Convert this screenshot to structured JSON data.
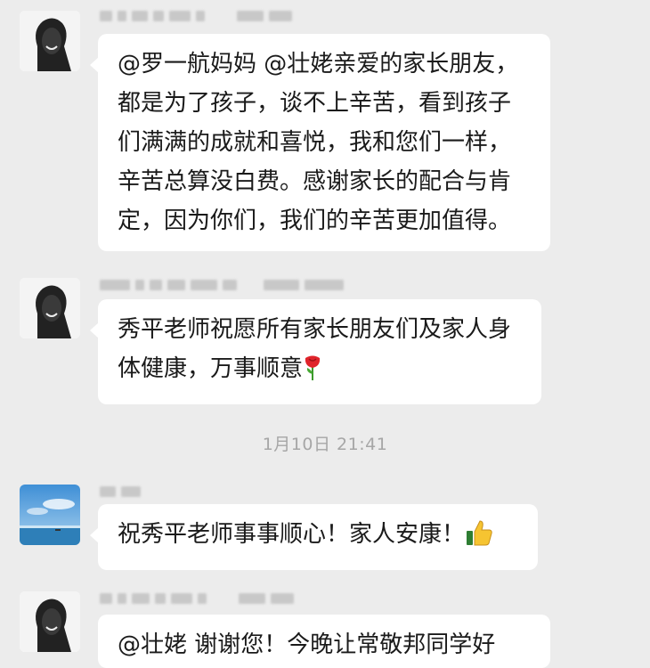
{
  "messages": [
    {
      "avatar": "dark-silhouette-avatar",
      "text": "@罗一航妈妈 @壮姥亲爱的家长朋友， 都是为了孩子，谈不上辛苦，看到孩子们满满的成就和喜悦，我和您们一样，辛苦总算没白费。感谢家长的配合与肯定，因为你们，我们的辛苦更加值得。"
    },
    {
      "avatar": "dark-silhouette-avatar",
      "text": "秀平老师祝愿所有家长朋友们及家人身体健康，万事顺意",
      "emoji": "rose-icon"
    },
    {
      "avatar": "sea-sky-avatar",
      "text": "祝秀平老师事事顺心！家人安康！",
      "emoji": "thumbs-up-icon"
    },
    {
      "avatar": "dark-silhouette-avatar",
      "text": "@壮姥 谢谢您！今晚让常敬邦同学好"
    }
  ],
  "timestamp": "1月10日 21:41",
  "colors": {
    "background": "#ececec",
    "bubble": "#ffffff",
    "timestamp_text": "#a6a6a6"
  }
}
